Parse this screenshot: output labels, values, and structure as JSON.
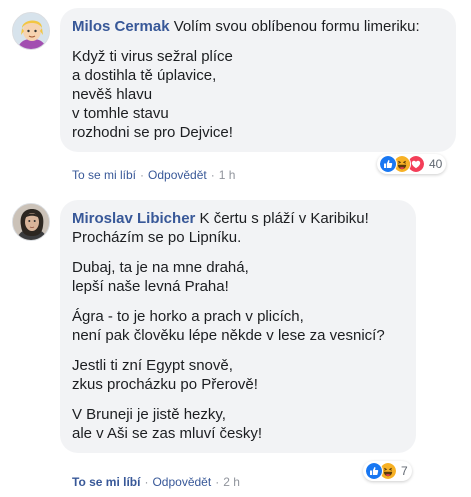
{
  "comments": [
    {
      "author": "Milos Cermak",
      "first_line": "Volím svou oblíbenou formu limeriku:",
      "paragraphs": [
        [
          "Když ti virus sežral plíce",
          "a dostihla tě úplavice,",
          "nevěš hlavu",
          "v tomhle stavu",
          "rozhodni se pro Dejvice!"
        ]
      ],
      "reaction_icons": [
        "like-icon",
        "haha-icon",
        "love-icon"
      ],
      "reaction_count": "40",
      "actions": {
        "like": "To se mi líbí",
        "reply": "Odpovědět",
        "time": "1 h"
      }
    },
    {
      "author": "Miroslav Libicher",
      "first_line": "K čertu s pláží v Karibiku!",
      "paragraphs": [
        [
          "Procházím se po Lipníku."
        ],
        [
          "Dubaj, ta je na mne drahá,",
          "lepší naše levná Praha!"
        ],
        [
          "Ágra - to je horko a prach v plicích,",
          "není pak člověku lépe někde v lese za vesnicí?"
        ],
        [
          "Jestli ti zní Egypt snově,",
          "zkus procházku po Přerově!"
        ],
        [
          "V Bruneji je jistě hezky,",
          "ale v Aši se zas mluví česky!"
        ]
      ],
      "reaction_icons": [
        "like-icon",
        "haha-icon"
      ],
      "reaction_count": "7",
      "actions": {
        "like": "To se mi líbí",
        "reply": "Odpovědět",
        "time": "2 h"
      }
    }
  ],
  "colors": {
    "author": "#385898",
    "bubble": "#f2f3f5",
    "like": "#1877f2",
    "haha": "#f7b125",
    "love": "#f33e58"
  }
}
